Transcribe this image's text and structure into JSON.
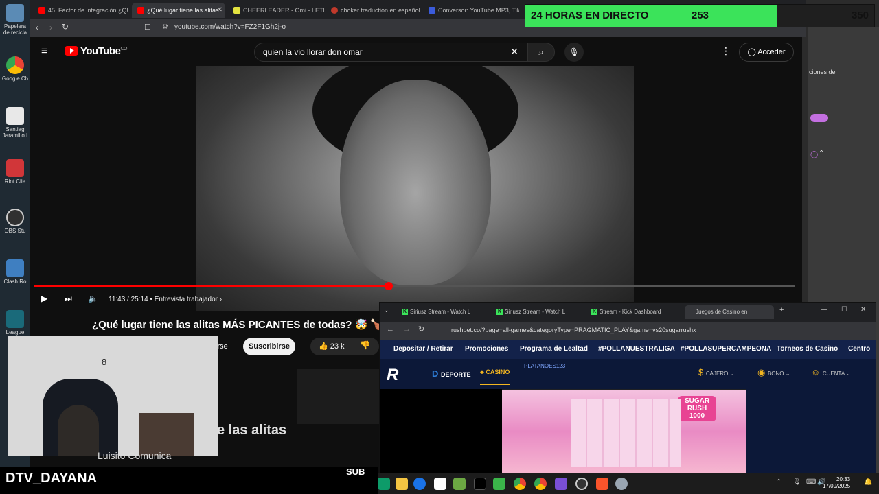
{
  "desktop": {
    "icons": [
      {
        "label": "Papelera de recicla"
      },
      {
        "label": "Google Ch"
      },
      {
        "label": "Santiag Jaramillo I"
      },
      {
        "label": "Riot Clie"
      },
      {
        "label": "OBS Stu"
      },
      {
        "label": "Clash Ro"
      },
      {
        "label": "League"
      }
    ]
  },
  "browser": {
    "tabs": [
      {
        "label": "45. Factor de integración ¿QUÉ",
        "color": "#ff0000"
      },
      {
        "label": "¿Qué lugar tiene las alitas",
        "color": "#ff0000"
      },
      {
        "label": "CHEERLEADER - Omi - LETRAS",
        "color": "#e3e340"
      },
      {
        "label": "choker traduction en español",
        "color": "#c0392b"
      },
      {
        "label": "Conversor: YouTube MP3, Tikt",
        "color": "#3b5bdb"
      }
    ],
    "url": "youtube.com/watch?v=FZ2F1Gh2j-o"
  },
  "youtube": {
    "logo": "YouTube",
    "country": "CO",
    "search_value": "quien la vio llorar don omar",
    "signin_label": "Acceder",
    "time_display": "11:43 / 25:14",
    "chapter": "Entrevista trabajador",
    "progress": 0.466,
    "video_title": "¿Qué lugar tiene las alitas MÁS PICANTES de todas? 🤯 🍗 🔥",
    "subscribe_partial": "irse",
    "subscribe_label": "Suscribirse",
    "likes": "23 k",
    "overlay_text": "e las alitas",
    "channel": "Luisito Comunica"
  },
  "stream": {
    "banner_label": "24 HORAS EN DIRECTO",
    "current": "253",
    "goal": "350",
    "progress": 0.723,
    "accent": "#3be35a",
    "streamer": "DTV_DAYANA",
    "sub_label": "SUB"
  },
  "casino_window": {
    "tabs": [
      {
        "label": "Siriusz Stream - Watch L"
      },
      {
        "label": "Siriusz Stream - Watch L"
      },
      {
        "label": "Stream - Kick Dashboard"
      },
      {
        "label": "Juegos de Casino en"
      }
    ],
    "url": "rushbet.co/?page=all-games&categoryType=PRAGMATIC_PLAY&game=vs20sugarrushx",
    "nav": [
      "Depositar / Retirar",
      "Promociones",
      "Programa de Lealtad",
      "#POLLANUESTRALIGA",
      "#POLLASUPERCAMPEONA",
      "Torneos de Casino",
      "Centro"
    ],
    "deporte_label": "DEPORTE",
    "casino_label": "CASINO",
    "username": "PLATANOES123",
    "cajero_label": "CAJERO",
    "bono_label": "BONO",
    "cuenta_label": "CUENTA",
    "game_logo": "SUGAR RUSH 1000"
  },
  "right_panel": {
    "partial_text": "ciones de"
  },
  "taskbar": {
    "time": "20:33",
    "date": "17/09/2025"
  }
}
